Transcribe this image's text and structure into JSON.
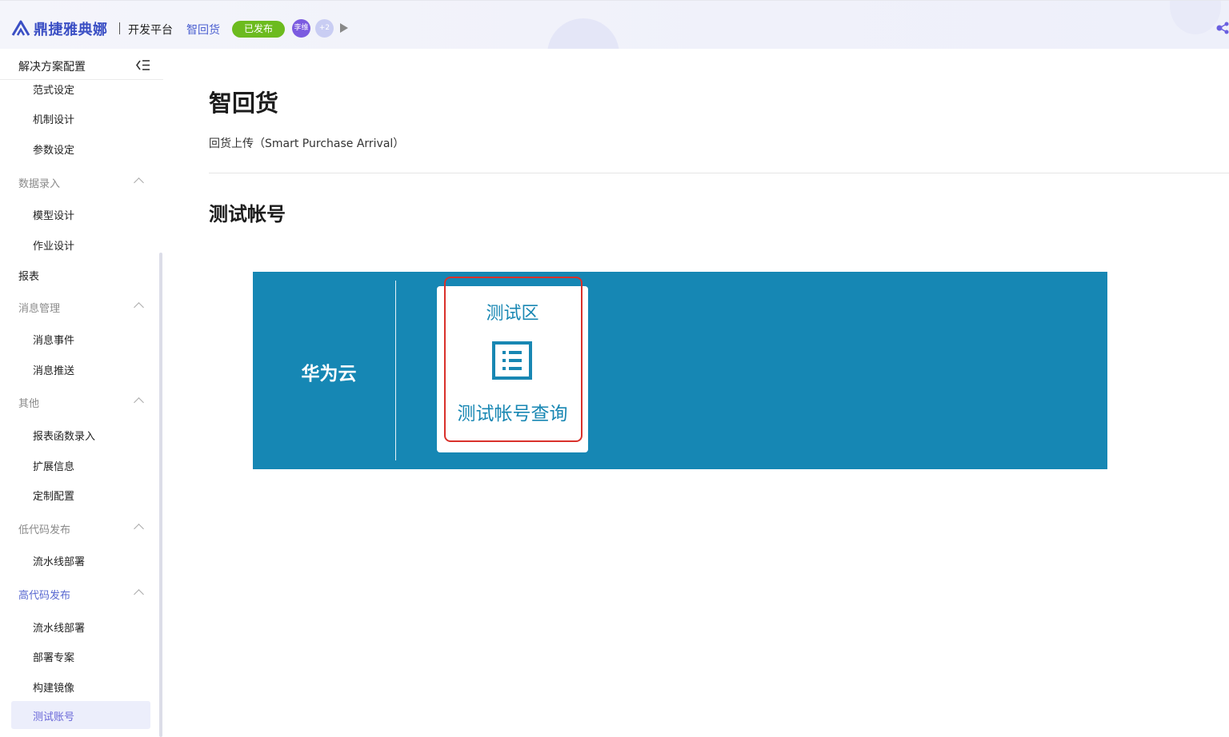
{
  "header": {
    "brand": "鼎捷雅典娜",
    "platform": "开发平台",
    "app_name": "智回货",
    "status_badge": "已发布",
    "avatar_text": "李维",
    "avatar_more": "+2",
    "colors": {
      "brand": "#3b4fc4",
      "badge": "#6cbb1e",
      "avatar": "#7b5be0"
    }
  },
  "sidebar": {
    "title": "解决方案配置",
    "items": [
      {
        "label": "范式设定",
        "kind": "child"
      },
      {
        "label": "机制设计",
        "kind": "child"
      },
      {
        "label": "参数设定",
        "kind": "child"
      },
      {
        "label": "数据录入",
        "kind": "group",
        "expanded": true
      },
      {
        "label": "模型设计",
        "kind": "child"
      },
      {
        "label": "作业设计",
        "kind": "child"
      },
      {
        "label": "报表",
        "kind": "top"
      },
      {
        "label": "消息管理",
        "kind": "group",
        "expanded": true
      },
      {
        "label": "消息事件",
        "kind": "child"
      },
      {
        "label": "消息推送",
        "kind": "child"
      },
      {
        "label": "其他",
        "kind": "group",
        "expanded": true
      },
      {
        "label": "报表函数录入",
        "kind": "child"
      },
      {
        "label": "扩展信息",
        "kind": "child"
      },
      {
        "label": "定制配置",
        "kind": "child"
      },
      {
        "label": "低代码发布",
        "kind": "group",
        "expanded": true
      },
      {
        "label": "流水线部署",
        "kind": "child"
      },
      {
        "label": "高代码发布",
        "kind": "group",
        "expanded": true,
        "active": true
      },
      {
        "label": "流水线部署",
        "kind": "child"
      },
      {
        "label": "部署专案",
        "kind": "child"
      },
      {
        "label": "构建镜像",
        "kind": "child"
      },
      {
        "label": "测试账号",
        "kind": "child",
        "selected": true
      }
    ]
  },
  "main": {
    "title": "智回货",
    "subtitle": "回货上传（Smart Purchase Arrival）",
    "section_title": "测试帐号",
    "panel": {
      "cloud_label": "华为云",
      "card": {
        "area_label": "测试区",
        "icon": "list-icon",
        "action_label": "测试帐号查询"
      },
      "colors": {
        "panel_bg": "#1687b4",
        "card_text": "#1887b3",
        "highlight": "#d9312b"
      }
    }
  }
}
